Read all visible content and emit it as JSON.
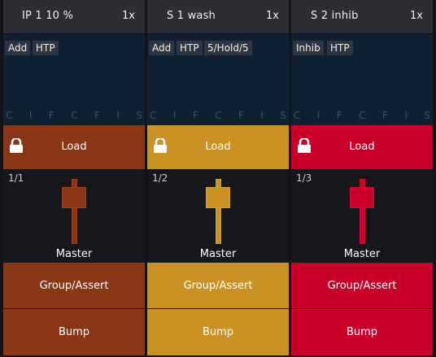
{
  "faders": [
    {
      "id": "f1",
      "title": "IP 1  10 %",
      "rate": "1x",
      "props": [
        "Add",
        "HTP"
      ],
      "channels": [
        "C",
        "I",
        "F",
        "C",
        "F",
        "I",
        "S"
      ],
      "load_label": "Load",
      "index": "1/1",
      "master_label": "Master",
      "group_label": "Group/Assert",
      "bump_label": "Bump",
      "color": "#8a3718",
      "fader_level": 0.8
    },
    {
      "id": "f2",
      "title": "S 1  wash",
      "rate": "1x",
      "props": [
        "Add",
        "HTP",
        "5/Hold/5"
      ],
      "channels": [
        "C",
        "I",
        "F",
        "C",
        "F",
        "I",
        "S"
      ],
      "load_label": "Load",
      "index": "1/2",
      "master_label": "Master",
      "group_label": "Group/Assert",
      "bump_label": "Bump",
      "color": "#c99222",
      "fader_level": 0.8
    },
    {
      "id": "f3",
      "title": "S 2  inhib",
      "rate": "1x",
      "props": [
        "Inhib",
        "HTP"
      ],
      "channels": [
        "C",
        "I",
        "F",
        "C",
        "F",
        "I",
        "S"
      ],
      "load_label": "Load",
      "index": "1/3",
      "master_label": "Master",
      "group_label": "Group/Assert",
      "bump_label": "Bump",
      "color": "#c8002a",
      "fader_level": 0.8
    }
  ]
}
